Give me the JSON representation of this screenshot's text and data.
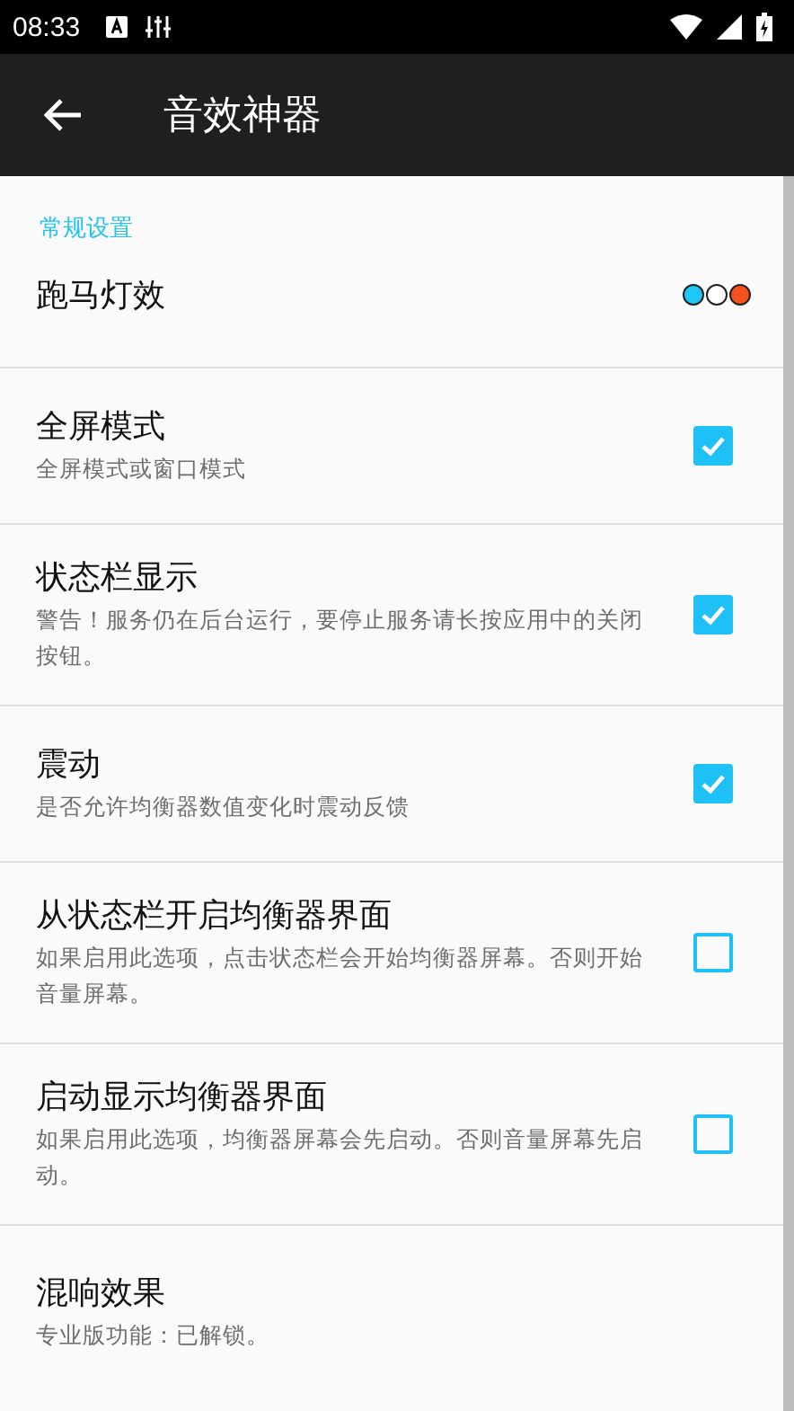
{
  "status_bar": {
    "time": "08:33"
  },
  "app_bar": {
    "title": "音效神器"
  },
  "section": {
    "title": "常规设置"
  },
  "settings": [
    {
      "kind": "dots",
      "title": "跑马灯效",
      "dots": [
        {
          "color": "#1ec8f5"
        },
        {
          "color": "#ffffff"
        },
        {
          "color": "#f4511e"
        }
      ]
    },
    {
      "kind": "checkbox",
      "title": "全屏模式",
      "summary": "全屏模式或窗口模式",
      "checked": true
    },
    {
      "kind": "checkbox",
      "title": "状态栏显示",
      "summary": "警告！服务仍在后台运行，要停止服务请长按应用中的关闭按钮。",
      "checked": true
    },
    {
      "kind": "checkbox",
      "title": "震动",
      "summary": "是否允许均衡器数值变化时震动反馈",
      "checked": true
    },
    {
      "kind": "checkbox",
      "title": "从状态栏开启均衡器界面",
      "summary": "如果启用此选项，点击状态栏会开始均衡器屏幕。否则开始音量屏幕。",
      "checked": false
    },
    {
      "kind": "checkbox",
      "title": "启动显示均衡器界面",
      "summary": "如果启用此选项，均衡器屏幕会先启动。否则音量屏幕先启动。",
      "checked": false
    },
    {
      "kind": "plain",
      "title": "混响效果",
      "summary": "专业版功能：已解锁。"
    }
  ]
}
